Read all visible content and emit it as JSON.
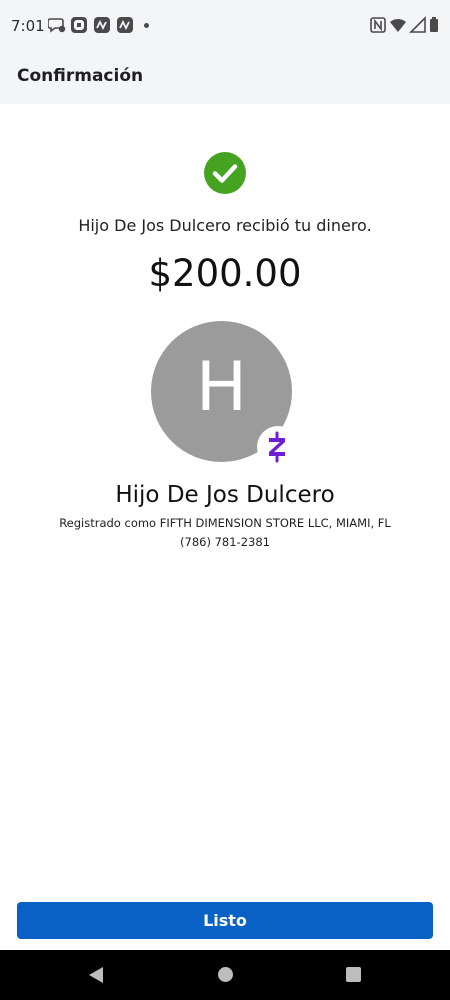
{
  "status_bar": {
    "time": "7:01",
    "left_icons": [
      "chat-bubble-icon",
      "chase-logo-icon",
      "zelle-notification-icon",
      "zelle-notification-icon"
    ],
    "right_icons": [
      "nfc-icon",
      "wifi-icon",
      "signal-icon",
      "battery-icon"
    ]
  },
  "header": {
    "title": "Confirmación"
  },
  "confirmation": {
    "status_icon": "check-circle-icon",
    "message": "Hijo De Jos Dulcero recibió tu dinero.",
    "amount": "$200.00"
  },
  "recipient": {
    "initial": "H",
    "badge_icon": "zelle-icon",
    "name": "Hijo De Jos Dulcero",
    "registered_as": "Registrado como FIFTH DIMENSION STORE LLC, MIAMI, FL",
    "phone": "(786) 781-2381"
  },
  "actions": {
    "done_label": "Listo"
  },
  "nav_bar": {
    "buttons": [
      "back-icon",
      "home-icon",
      "recents-icon"
    ]
  },
  "colors": {
    "accent_blue": "#0a61c5",
    "success_green": "#46a321",
    "zelle_purple": "#6d1ed4",
    "avatar_gray": "#9b9b9b",
    "header_bg": "#f4f5f7"
  }
}
